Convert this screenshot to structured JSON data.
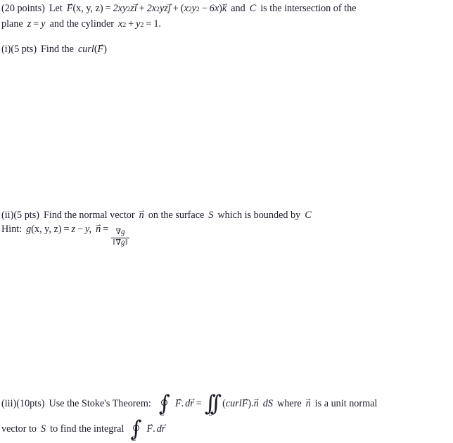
{
  "document": {
    "type": "math-exam-question",
    "background_color": "#ffffff",
    "text_color": "#1a1a28"
  },
  "problem": {
    "points_label": "(20 points)",
    "lead_in": "Let",
    "field_name": "F",
    "field_args": "(x, y, z)",
    "equals": "=",
    "term1_coeff": "2",
    "term1_vars": "xy",
    "term1_exp": "2",
    "term1_tail": "z",
    "term1_unit": "i",
    "plus1": "+",
    "term2_coeff": "2",
    "term2_var": "x",
    "term2_exp": "2",
    "term2_tail": "yz",
    "term2_unit": "j",
    "plus2": "+",
    "term3_open": "(",
    "term3_a": "x",
    "term3_a_exp": "2",
    "term3_b": "y",
    "term3_b_exp": "2",
    "term3_minus": "−",
    "term3_c": "6x",
    "term3_close": ")",
    "term3_unit": "k",
    "and_text": "and",
    "curve_name": "C",
    "tail_text": "is the intersection of the",
    "line2_a": "plane",
    "plane_z": "z",
    "plane_eq": "=",
    "plane_y": "y",
    "line2_b": "and the cylinder",
    "cyl_x": "x",
    "cyl_x_exp": "2",
    "cyl_plus": "+",
    "cyl_y": "y",
    "cyl_y_exp": "2",
    "cyl_eq": "=",
    "cyl_val": "1."
  },
  "part_i": {
    "number": "(i)(5 pts)",
    "instruction": "Find the",
    "operator": "curl",
    "open_paren": "(",
    "argument": "F",
    "close_paren": ")"
  },
  "part_ii": {
    "number": "(ii)(5 pts)",
    "text_a": "Find the normal vector",
    "normal_symbol": "n",
    "text_b": "on the surface",
    "surface": "S",
    "text_c": "which is bounded by",
    "curve": "C",
    "hint_label": "Hint:",
    "hint_g": "g",
    "hint_g_args": "(x, y, z)",
    "hint_eq1": "=",
    "hint_z": "z",
    "hint_minus": "−",
    "hint_y": "y,",
    "hint_n": "n",
    "hint_eq2": "=",
    "frac_num_nabla": "∇",
    "frac_num_g": "g",
    "frac_den_open": "‖",
    "frac_den_nabla": "∇",
    "frac_den_g": "g",
    "frac_den_close": "‖"
  },
  "part_iii": {
    "number": "(iii)(10pts)",
    "text_a": "Use the Stoke's Theorem:",
    "int1_symbol": "∫",
    "int1_limit": "C",
    "int1_field": "F",
    "int1_dot": ".",
    "int1_d": "d",
    "int1_r": "r",
    "equals": "=",
    "int2_symbol": "∫",
    "int2_limit": "S",
    "int2_open": "(",
    "int2_curl": "curl",
    "int2_field": "F",
    "int2_close": ")",
    "int2_dot": ".",
    "int2_n": "n",
    "int2_dS_d": "d",
    "int2_dS_S": "S",
    "text_b": "where",
    "unit_n": "n",
    "text_c": "is a unit normal",
    "line2_a": "vector to",
    "line2_S": "S",
    "line2_b": "to find the integral",
    "int3_symbol": "∫",
    "int3_limit": "C",
    "int3_field": "F",
    "int3_dot": ".",
    "int3_d": "d",
    "int3_r": "r"
  },
  "icons": {
    "vector_arrow": "⃗",
    "contour_circle": "circle-overlay"
  }
}
